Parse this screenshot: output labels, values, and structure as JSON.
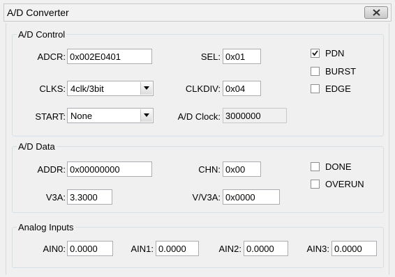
{
  "window": {
    "title": "A/D Converter",
    "close_icon": "close-icon"
  },
  "ad_control": {
    "legend": "A/D Control",
    "adcr": {
      "label": "ADCR:",
      "value": "0x002E0401"
    },
    "sel": {
      "label": "SEL:",
      "value": "0x01"
    },
    "clks": {
      "label": "CLKS:",
      "value": "4clk/3bit"
    },
    "clkdiv": {
      "label": "CLKDIV:",
      "value": "0x04"
    },
    "start": {
      "label": "START:",
      "value": "None"
    },
    "ad_clock": {
      "label": "A/D Clock:",
      "value": "3000000"
    },
    "pdn": {
      "label": "PDN",
      "checked": true
    },
    "burst": {
      "label": "BURST",
      "checked": false
    },
    "edge": {
      "label": "EDGE",
      "checked": false
    }
  },
  "ad_data": {
    "legend": "A/D Data",
    "addr": {
      "label": "ADDR:",
      "value": "0x00000000"
    },
    "chn": {
      "label": "CHN:",
      "value": "0x00"
    },
    "v3a": {
      "label": "V3A:",
      "value": "3.3000"
    },
    "vv3a": {
      "label": "V/V3A:",
      "value": "0x0000"
    },
    "done": {
      "label": "DONE",
      "checked": false
    },
    "overun": {
      "label": "OVERUN",
      "checked": false
    }
  },
  "analog_inputs": {
    "legend": "Analog Inputs",
    "ain0": {
      "label": "AIN0:",
      "value": "0.0000"
    },
    "ain1": {
      "label": "AIN1:",
      "value": "0.0000"
    },
    "ain2": {
      "label": "AIN2:",
      "value": "0.0000"
    },
    "ain3": {
      "label": "AIN3:",
      "value": "0.0000"
    }
  }
}
